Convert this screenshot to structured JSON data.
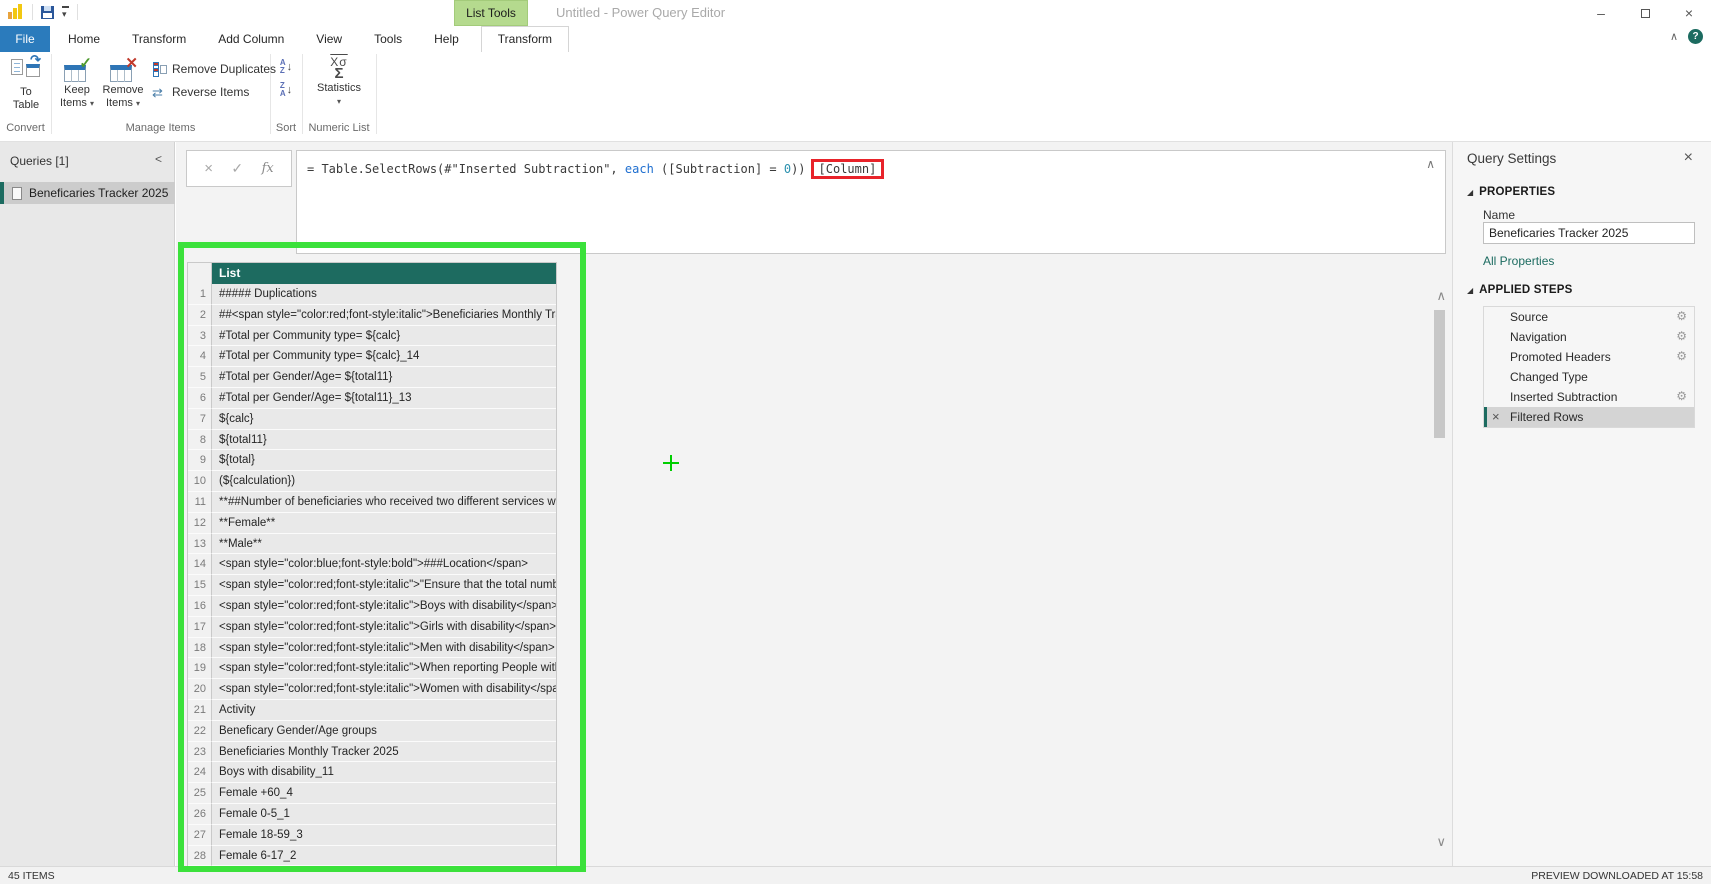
{
  "titlebar": {
    "context_tab": "List Tools",
    "title": "Untitled - Power Query Editor"
  },
  "ribbon": {
    "file_tab": "File",
    "tabs": [
      "Home",
      "Transform",
      "Add Column",
      "View",
      "Tools",
      "Help"
    ],
    "contextual_tab": "Transform",
    "groups": {
      "convert": {
        "label": "Convert",
        "to_table_line1": "To",
        "to_table_line2": "Table"
      },
      "manage_items": {
        "label": "Manage Items",
        "keep_line1": "Keep",
        "keep_line2": "Items",
        "remove_line1": "Remove",
        "remove_line2": "Items",
        "remove_duplicates": "Remove Duplicates",
        "reverse_items": "Reverse Items"
      },
      "sort": {
        "label": "Sort"
      },
      "numeric_list": {
        "label": "Numeric List",
        "statistics": "Statistics"
      }
    }
  },
  "formula_bar": {
    "prefix": "= Table.SelectRows(#\"Inserted Subtraction\", ",
    "keyword": "each",
    "mid": " ([Subtraction] = ",
    "number": "0",
    "close": "))",
    "highlighted": "[Column]"
  },
  "queries_pane": {
    "header": "Queries [1]",
    "items": [
      {
        "name": "Beneficaries Tracker 2025",
        "selected": true
      }
    ]
  },
  "list_preview": {
    "column_header": "List",
    "rows": [
      "##### Duplications",
      "##<span style=\"color:red;font-style:italic\">Beneficiaries Monthly Track...",
      "#Total per Community type= ${calc}",
      "#Total per Community type= ${calc}_14",
      "#Total per Gender/Age= ${total11}",
      "#Total per Gender/Age= ${total11}_13",
      "${calc}",
      "${total11}",
      "${total}",
      "(${calculation})",
      "**##Number of beneficiaries who received two different services with...",
      "**Female**",
      "**Male**",
      "<span style=\"color:blue;font-style:bold\">###Location</span>",
      "<span style=\"color:red;font-style:italic\">\"Ensure that the total number...",
      "<span style=\"color:red;font-style:italic\">Boys with disability</span>",
      "<span style=\"color:red;font-style:italic\">Girls with disability</span>",
      "<span style=\"color:red;font-style:italic\">Men with disability</span>",
      "<span style=\"color:red;font-style:italic\">When reporting People with ...",
      "<span style=\"color:red;font-style:italic\">Women with disability</span>",
      "Activity",
      "Beneficary Gender/Age groups",
      "Beneficiaries Monthly Tracker 2025",
      "Boys with disability_11",
      "Female +60_4",
      "Female 0-5_1",
      "Female 18-59_3",
      "Female 6-17_2"
    ]
  },
  "query_settings": {
    "title": "Query Settings",
    "properties_label": "PROPERTIES",
    "name_label": "Name",
    "name_value": "Beneficaries Tracker 2025",
    "all_properties": "All Properties",
    "applied_steps_label": "APPLIED STEPS",
    "steps": [
      {
        "name": "Source",
        "gear": true
      },
      {
        "name": "Navigation",
        "gear": true
      },
      {
        "name": "Promoted Headers",
        "gear": true
      },
      {
        "name": "Changed Type",
        "gear": false
      },
      {
        "name": "Inserted Subtraction",
        "gear": true
      },
      {
        "name": "Filtered Rows",
        "gear": false,
        "selected": true
      }
    ]
  },
  "status_bar": {
    "left": "45 ITEMS",
    "right": "PREVIEW DOWNLOADED AT 15:58"
  },
  "colors": {
    "accent_teal": "#1c6b60",
    "file_tab_blue": "#2b7bbc",
    "contextual_tab_green": "#b5da8e",
    "annotation_green": "#3be13b",
    "annotation_red": "#e8232a"
  }
}
